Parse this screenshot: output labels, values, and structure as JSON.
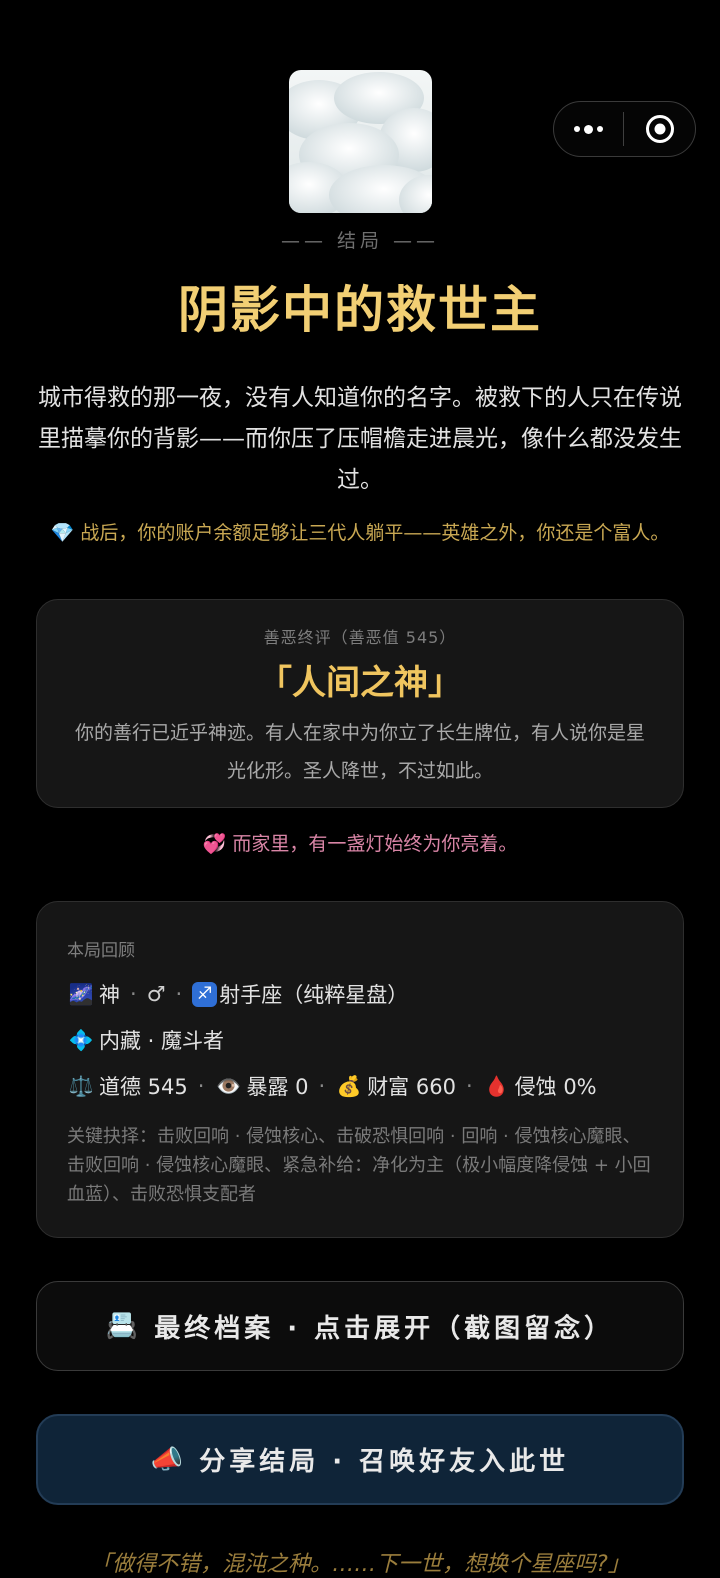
{
  "capsule": {
    "more_icon": "more-dots-icon",
    "close_icon": "target-close-icon"
  },
  "hero": {
    "image": "clouds-sky-image"
  },
  "ending_label": "—— 结局 ——",
  "title": "阴影中的救世主",
  "story": "城市得救的那一夜，没有人知道你的名字。被救下的人只在传说里描摹你的背影——而你压了压帽檐走进晨光，像什么都没发生过。",
  "wealth_note": {
    "icon": "💎",
    "text": "战后，你的账户余额足够让三代人躺平——英雄之外，你还是个富人。"
  },
  "verdict": {
    "label": "善恶终评（善恶值 545）",
    "name": "「人间之神」",
    "desc": "你的善行已近乎神迹。有人在家中为你立了长生牌位，有人说你是星光化形。圣人降世，不过如此。"
  },
  "home_note": {
    "icon": "💞",
    "text": "而家里，有一盏灯始终为你亮着。"
  },
  "review": {
    "heading": "本局回顾",
    "identity": {
      "icon": "🌌",
      "race": "神",
      "gender": "♂",
      "zodiac_icon": "♐",
      "zodiac": "射手座（纯粹星盘）"
    },
    "talent": {
      "icon": "💠",
      "text": "内藏 · 魔斗者"
    },
    "stats": [
      {
        "icon": "⚖️",
        "label": "道德 545"
      },
      {
        "icon": "👁️",
        "label": "暴露 0"
      },
      {
        "icon": "💰",
        "label": "财富 660"
      },
      {
        "icon": "🩸",
        "label": "侵蚀 0%"
      }
    ],
    "choices": "关键抉择：击败回响 · 侵蚀核心、击破恐惧回响 · 回响 · 侵蚀核心魔眼、击败回响 · 侵蚀核心魔眼、紧急补给：净化为主（极小幅度降侵蚀 + 小回血蓝）、击败恐惧支配者"
  },
  "buttons": {
    "archive_icon": "📇",
    "archive_label": "最终档案 · 点击展开（截图留念）",
    "share_icon": "📣",
    "share_label": "分享结局 · 召唤好友入此世"
  },
  "footer_quote": "「做得不错，混沌之种。……下一世，想换个星座吗?」",
  "colors": {
    "title": "#f2cf74",
    "wealth_note": "#c9a853",
    "home_note": "#d985a6",
    "share_bg": "#0f2438"
  }
}
